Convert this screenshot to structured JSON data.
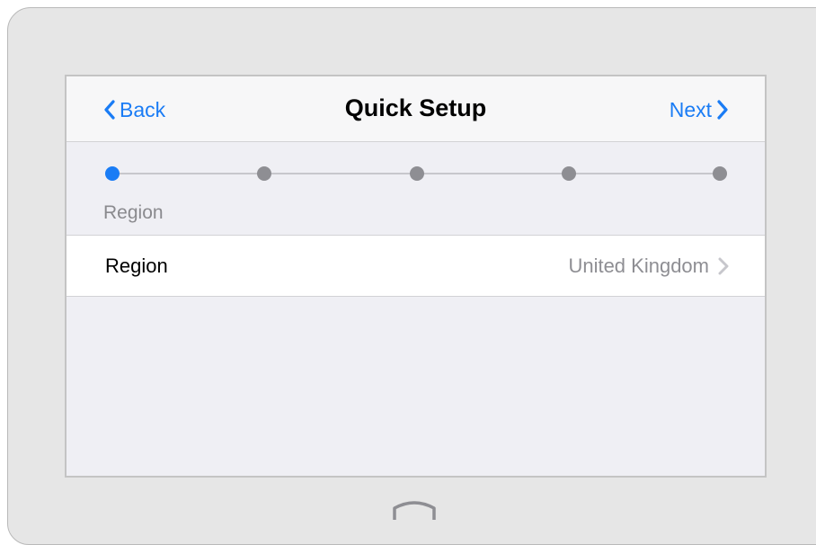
{
  "navbar": {
    "back_label": "Back",
    "title": "Quick Setup",
    "next_label": "Next"
  },
  "stepper": {
    "total_steps": 5,
    "current_step": 1,
    "current_label": "Region"
  },
  "settings": {
    "rows": [
      {
        "label": "Region",
        "value": "United Kingdom"
      }
    ]
  },
  "icons": {
    "back": "chevron-left-icon",
    "next": "chevron-right-icon",
    "row_disclosure": "chevron-right-icon",
    "home": "home-button-icon"
  },
  "colors": {
    "accent": "#1a7cf5",
    "inactive_dot": "#8e8e93",
    "secondary_text": "#8e8e93",
    "device_frame": "#e6e6e6"
  }
}
